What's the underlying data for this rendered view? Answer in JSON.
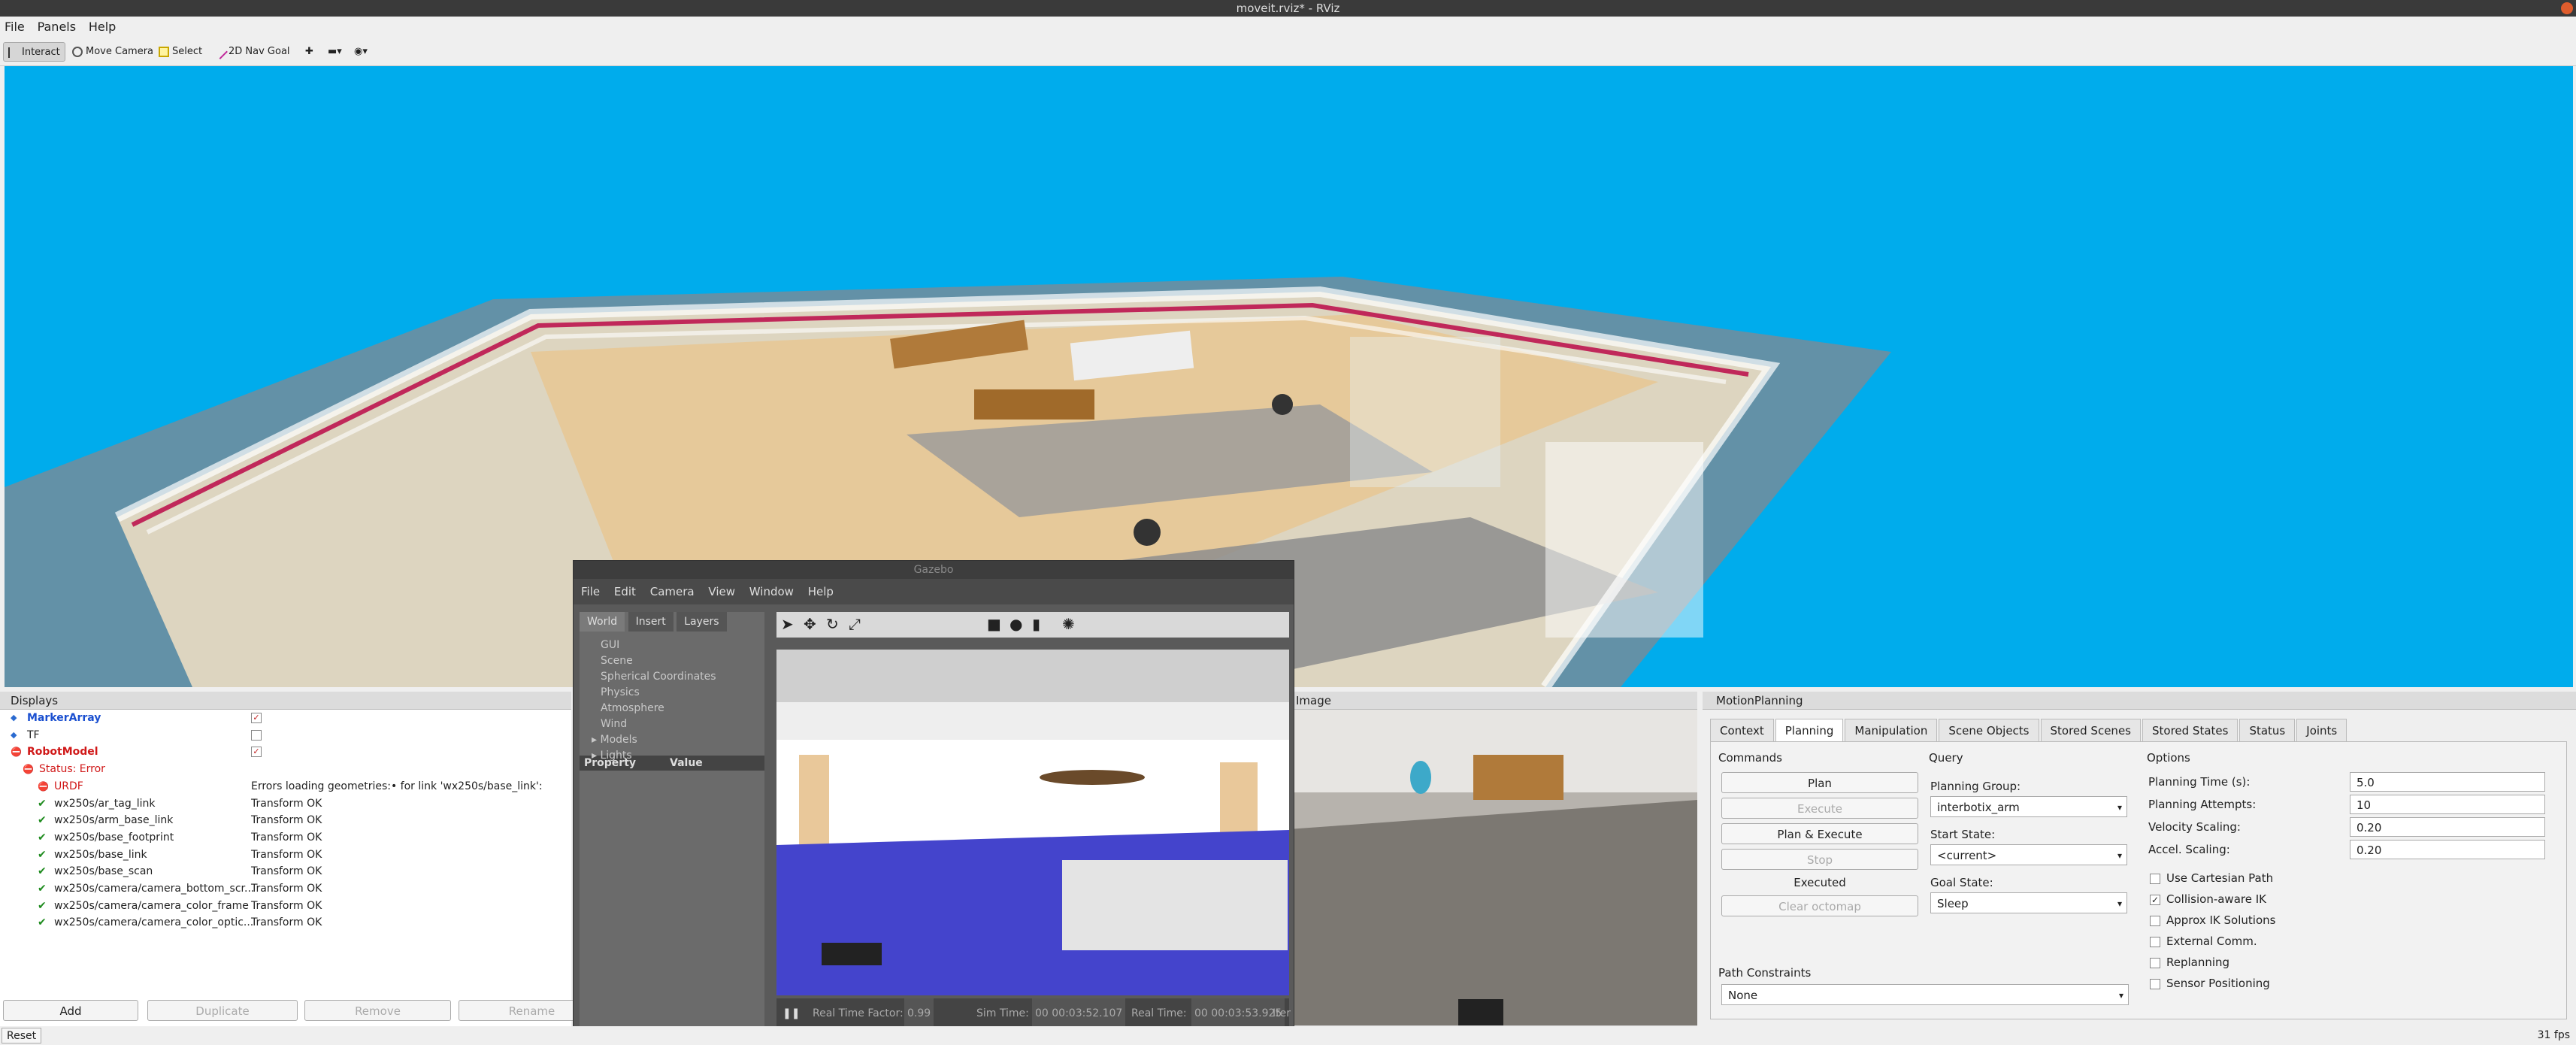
{
  "window": {
    "title": "moveit.rviz* - RViz"
  },
  "menu": [
    "File",
    "Panels",
    "Help"
  ],
  "toolbar": {
    "interact": "Interact",
    "move_camera": "Move Camera",
    "select": "Select",
    "nav_goal": "2D Nav Goal"
  },
  "displays": {
    "title": "Displays",
    "rows": [
      {
        "name": "MarkerArray",
        "value": "✓",
        "style": "blue"
      },
      {
        "name": "TF",
        "value": "",
        "style": "normal"
      },
      {
        "name": "RobotModel",
        "value": "✓",
        "style": "red"
      },
      {
        "name": "Status: Error",
        "value": "",
        "style": "redsub"
      },
      {
        "name": "URDF",
        "value": "Errors loading geometries:• for link 'wx250s/base_link':",
        "style": "redsub2"
      },
      {
        "name": "wx250s/ar_tag_link",
        "value": "Transform OK",
        "style": "ok"
      },
      {
        "name": "wx250s/arm_base_link",
        "value": "Transform OK",
        "style": "ok"
      },
      {
        "name": "wx250s/base_footprint",
        "value": "Transform OK",
        "style": "ok"
      },
      {
        "name": "wx250s/base_link",
        "value": "Transform OK",
        "style": "ok"
      },
      {
        "name": "wx250s/base_scan",
        "value": "Transform OK",
        "style": "ok"
      },
      {
        "name": "wx250s/camera/camera_bottom_scr...",
        "value": "Transform OK",
        "style": "ok"
      },
      {
        "name": "wx250s/camera/camera_color_frame",
        "value": "Transform OK",
        "style": "ok"
      },
      {
        "name": "wx250s/camera/camera_color_optic...",
        "value": "Transform OK",
        "style": "ok"
      }
    ],
    "buttons": {
      "add": "Add",
      "duplicate": "Duplicate",
      "remove": "Remove",
      "rename": "Rename"
    }
  },
  "gazebo": {
    "title": "Gazebo",
    "menu": [
      "File",
      "Edit",
      "Camera",
      "View",
      "Window",
      "Help"
    ],
    "tabs": [
      "World",
      "Insert",
      "Layers"
    ],
    "tree": [
      "GUI",
      "Scene",
      "Spherical Coordinates",
      "Physics",
      "Atmosphere",
      "Wind",
      "Models",
      "Lights"
    ],
    "property_header": "Property",
    "value_header": "Value",
    "rtf_label": "Real Time Factor:",
    "rtf_value": "0.99",
    "sim_label": "Sim Time:",
    "sim_value": "00 00:03:52.107",
    "real_label": "Real Time:",
    "real_value": "00 00:03:53.925",
    "iter_label": "Iter"
  },
  "image_panel": {
    "title": "Image"
  },
  "motion": {
    "title": "MotionPlanning",
    "tabs": [
      "Context",
      "Planning",
      "Manipulation",
      "Scene Objects",
      "Stored Scenes",
      "Stored States",
      "Status",
      "Joints"
    ],
    "commands_label": "Commands",
    "plan": "Plan",
    "execute": "Execute",
    "plan_execute": "Plan & Execute",
    "stop": "Stop",
    "executed": "Executed",
    "clear_octomap": "Clear octomap",
    "query_label": "Query",
    "planning_group_label": "Planning Group:",
    "planning_group": "interbotix_arm",
    "start_state_label": "Start State:",
    "start_state": "<current>",
    "goal_state_label": "Goal State:",
    "goal_state": "Sleep",
    "options_label": "Options",
    "planning_time_label": "Planning Time (s):",
    "planning_time": "5.0",
    "planning_attempts_label": "Planning Attempts:",
    "planning_attempts": "10",
    "velocity_label": "Velocity Scaling:",
    "velocity": "0.20",
    "accel_label": "Accel. Scaling:",
    "accel": "0.20",
    "checks": [
      {
        "label": "Use Cartesian Path",
        "checked": false
      },
      {
        "label": "Collision-aware IK",
        "checked": true
      },
      {
        "label": "Approx IK Solutions",
        "checked": false
      },
      {
        "label": "External Comm.",
        "checked": false
      },
      {
        "label": "Replanning",
        "checked": false
      },
      {
        "label": "Sensor Positioning",
        "checked": false
      }
    ],
    "path_constraints_label": "Path Constraints",
    "path_constraints": "None"
  },
  "status": {
    "reset": "Reset",
    "fps": "31 fps"
  }
}
